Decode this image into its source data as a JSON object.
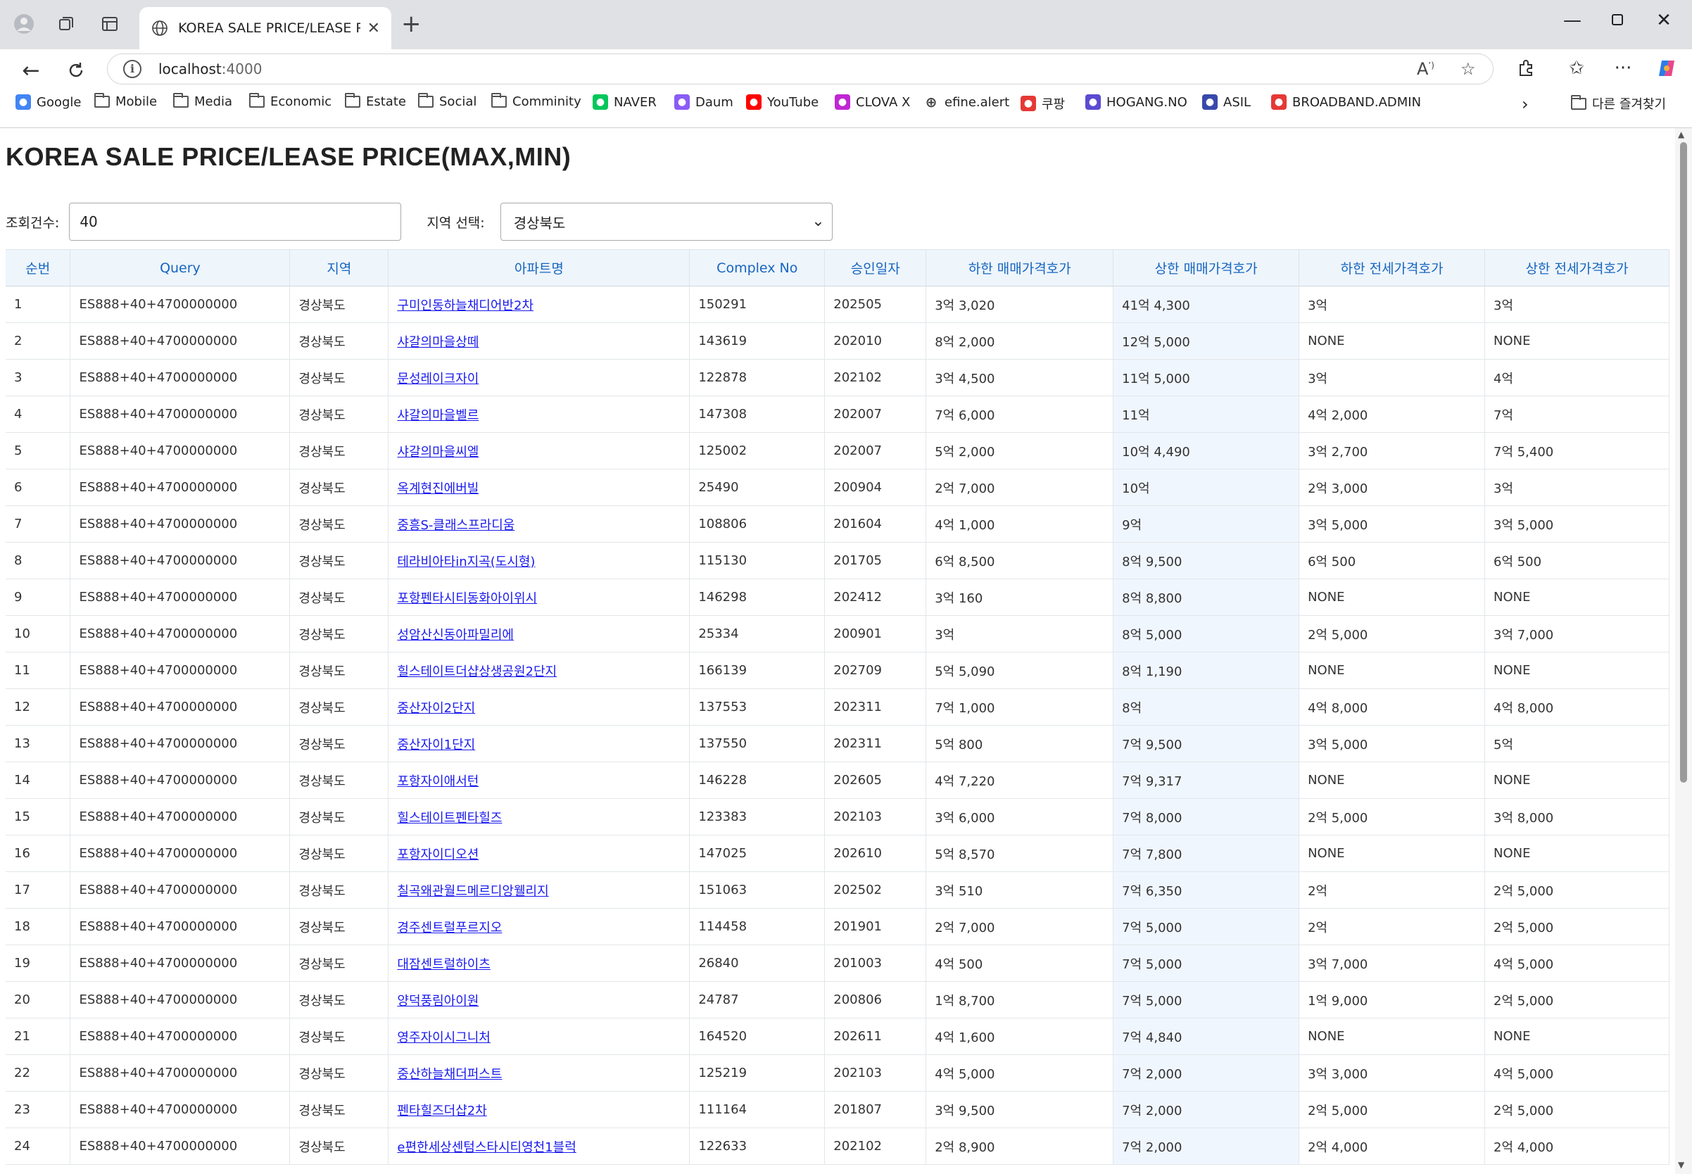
{
  "browser": {
    "tab_title": "KOREA SALE PRICE/LEASE PRICE(",
    "url_host": "localhost",
    "url_port": ":4000",
    "bookmarks": [
      {
        "label": "Google",
        "icon": "google-icon",
        "color": "#4285f4"
      },
      {
        "label": "Mobile",
        "icon": "folder-icon"
      },
      {
        "label": "Media",
        "icon": "folder-icon"
      },
      {
        "label": "Economic",
        "icon": "folder-icon"
      },
      {
        "label": "Estate",
        "icon": "folder-icon"
      },
      {
        "label": "Social",
        "icon": "folder-icon"
      },
      {
        "label": "Comminity",
        "icon": "folder-icon"
      },
      {
        "label": "NAVER",
        "icon": "naver-icon",
        "color": "#03c75a"
      },
      {
        "label": "Daum",
        "icon": "daum-icon",
        "color": "#8a5cf6"
      },
      {
        "label": "YouTube",
        "icon": "youtube-icon",
        "color": "#ff0000"
      },
      {
        "label": "CLOVA X",
        "icon": "clova-icon",
        "color": "#c026d3"
      },
      {
        "label": "efine.alert",
        "icon": "globe-icon"
      },
      {
        "label": "쿠팡",
        "icon": "coupang-icon",
        "color": "#e53935"
      },
      {
        "label": "HOGANG.NO",
        "icon": "hogang-icon",
        "color": "#5b4bd1"
      },
      {
        "label": "ASIL",
        "icon": "asil-icon",
        "color": "#3949ab"
      },
      {
        "label": "BROADBAND.ADMIN",
        "icon": "sk-icon",
        "color": "#e53935"
      }
    ],
    "other_bookmarks": "다른 즐겨찾기"
  },
  "page": {
    "title": "KOREA SALE PRICE/LEASE PRICE(MAX,MIN)",
    "count_label": "조회건수:",
    "count_value": "40",
    "region_label": "지역 선택:",
    "region_value": "경상북도"
  },
  "table": {
    "columns": [
      "순번",
      "Query",
      "지역",
      "아파트명",
      "Complex No",
      "승인일자",
      "하한 매매가격호가",
      "상한 매매가격호가",
      "하한 전세가격호가",
      "상한 전세가격호가"
    ],
    "rows": [
      [
        "1",
        "ES888+40+4700000000",
        "경상북도",
        "구미인동하늘채디어반2차",
        "150291",
        "202505",
        "3억 3,020",
        "41억 4,300",
        "3억",
        "3억"
      ],
      [
        "2",
        "ES888+40+4700000000",
        "경상북도",
        "샤갈의마을상떼",
        "143619",
        "202010",
        "8억 2,000",
        "12억 5,000",
        "NONE",
        "NONE"
      ],
      [
        "3",
        "ES888+40+4700000000",
        "경상북도",
        "문성레이크자이",
        "122878",
        "202102",
        "3억 4,500",
        "11억 5,000",
        "3억",
        "4억"
      ],
      [
        "4",
        "ES888+40+4700000000",
        "경상북도",
        "샤갈의마을벨르",
        "147308",
        "202007",
        "7억 6,000",
        "11억",
        "4억 2,000",
        "7억"
      ],
      [
        "5",
        "ES888+40+4700000000",
        "경상북도",
        "샤갈의마을씨엘",
        "125002",
        "202007",
        "5억 2,000",
        "10억 4,490",
        "3억 2,700",
        "7억 5,400"
      ],
      [
        "6",
        "ES888+40+4700000000",
        "경상북도",
        "옥계현진에버빌",
        "25490",
        "200904",
        "2억 7,000",
        "10억",
        "2억 3,000",
        "3억"
      ],
      [
        "7",
        "ES888+40+4700000000",
        "경상북도",
        "중흥S-클래스프라디움",
        "108806",
        "201604",
        "4억 1,000",
        "9억",
        "3억 5,000",
        "3억 5,000"
      ],
      [
        "8",
        "ES888+40+4700000000",
        "경상북도",
        "테라비아타in지곡(도시형)",
        "115130",
        "201705",
        "6억 8,500",
        "8억 9,500",
        "6억 500",
        "6억 500"
      ],
      [
        "9",
        "ES888+40+4700000000",
        "경상북도",
        "포항펜타시티동화아이위시",
        "146298",
        "202412",
        "3억 160",
        "8억 8,800",
        "NONE",
        "NONE"
      ],
      [
        "10",
        "ES888+40+4700000000",
        "경상북도",
        "성암산신동아파밀리에",
        "25334",
        "200901",
        "3억",
        "8억 5,000",
        "2억 5,000",
        "3억 7,000"
      ],
      [
        "11",
        "ES888+40+4700000000",
        "경상북도",
        "힐스테이트더샵상생공원2단지",
        "166139",
        "202709",
        "5억 5,090",
        "8억 1,190",
        "NONE",
        "NONE"
      ],
      [
        "12",
        "ES888+40+4700000000",
        "경상북도",
        "중산자이2단지",
        "137553",
        "202311",
        "7억 1,000",
        "8억",
        "4억 8,000",
        "4억 8,000"
      ],
      [
        "13",
        "ES888+40+4700000000",
        "경상북도",
        "중산자이1단지",
        "137550",
        "202311",
        "5억 800",
        "7억 9,500",
        "3억 5,000",
        "5억"
      ],
      [
        "14",
        "ES888+40+4700000000",
        "경상북도",
        "포항자이애서턴",
        "146228",
        "202605",
        "4억 7,220",
        "7억 9,317",
        "NONE",
        "NONE"
      ],
      [
        "15",
        "ES888+40+4700000000",
        "경상북도",
        "힐스테이트펜타힐즈",
        "123383",
        "202103",
        "3억 6,000",
        "7억 8,000",
        "2억 5,000",
        "3억 8,000"
      ],
      [
        "16",
        "ES888+40+4700000000",
        "경상북도",
        "포항자이디오션",
        "147025",
        "202610",
        "5억 8,570",
        "7억 7,800",
        "NONE",
        "NONE"
      ],
      [
        "17",
        "ES888+40+4700000000",
        "경상북도",
        "칠곡왜관월드메르디앙웰리지",
        "151063",
        "202502",
        "3억 510",
        "7억 6,350",
        "2억",
        "2억 5,000"
      ],
      [
        "18",
        "ES888+40+4700000000",
        "경상북도",
        "경주센트럴푸르지오",
        "114458",
        "201901",
        "2억 7,000",
        "7억 5,000",
        "2억",
        "2억 5,000"
      ],
      [
        "19",
        "ES888+40+4700000000",
        "경상북도",
        "대잠센트럴하이츠",
        "26840",
        "201003",
        "4억 500",
        "7억 5,000",
        "3억 7,000",
        "4억 5,000"
      ],
      [
        "20",
        "ES888+40+4700000000",
        "경상북도",
        "양덕풍림아이원",
        "24787",
        "200806",
        "1억 8,700",
        "7억 5,000",
        "1억 9,000",
        "2억 5,000"
      ],
      [
        "21",
        "ES888+40+4700000000",
        "경상북도",
        "영주자이시그니처",
        "164520",
        "202611",
        "4억 1,600",
        "7억 4,840",
        "NONE",
        "NONE"
      ],
      [
        "22",
        "ES888+40+4700000000",
        "경상북도",
        "중산하늘채더퍼스트",
        "125219",
        "202103",
        "4억 5,000",
        "7억 2,000",
        "3억 3,000",
        "4억 5,000"
      ],
      [
        "23",
        "ES888+40+4700000000",
        "경상북도",
        "펜타힐즈더샵2차",
        "111164",
        "201807",
        "3억 9,500",
        "7억 2,000",
        "2억 5,000",
        "2억 5,000"
      ],
      [
        "24",
        "ES888+40+4700000000",
        "경상북도",
        "e편한세상센텀스타시티영천1블럭",
        "122633",
        "202102",
        "2억 8,900",
        "7억 2,000",
        "2억 4,000",
        "2억 4,000"
      ]
    ]
  }
}
